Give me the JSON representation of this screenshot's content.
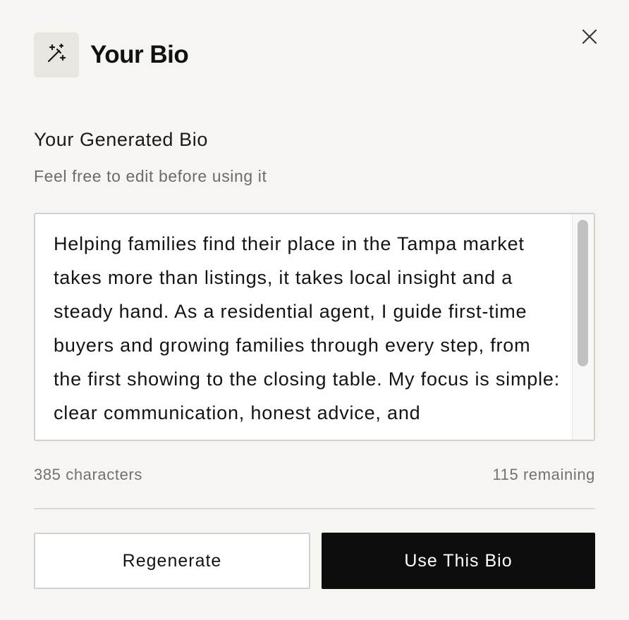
{
  "dialog": {
    "title": "Your Bio",
    "icon": "magic-wand-icon",
    "close_icon": "close-icon"
  },
  "section": {
    "title": "Your Generated Bio",
    "subtitle": "Feel free to edit before using it"
  },
  "bio": {
    "text": "Helping families find their place in the Tampa market takes more than listings, it takes local insight and a steady hand. As a residential agent, I guide first-time buyers and growing families through every step, from the first showing to the closing table. My focus is simple: clear communication, honest advice, and",
    "character_count": "385 characters",
    "remaining": "115 remaining"
  },
  "actions": {
    "regenerate_label": "Regenerate",
    "use_label": "Use This Bio"
  },
  "colors": {
    "background": "#f6f5f1",
    "primary_button": "#0d0d0d",
    "icon_box": "#e7e6e1"
  }
}
